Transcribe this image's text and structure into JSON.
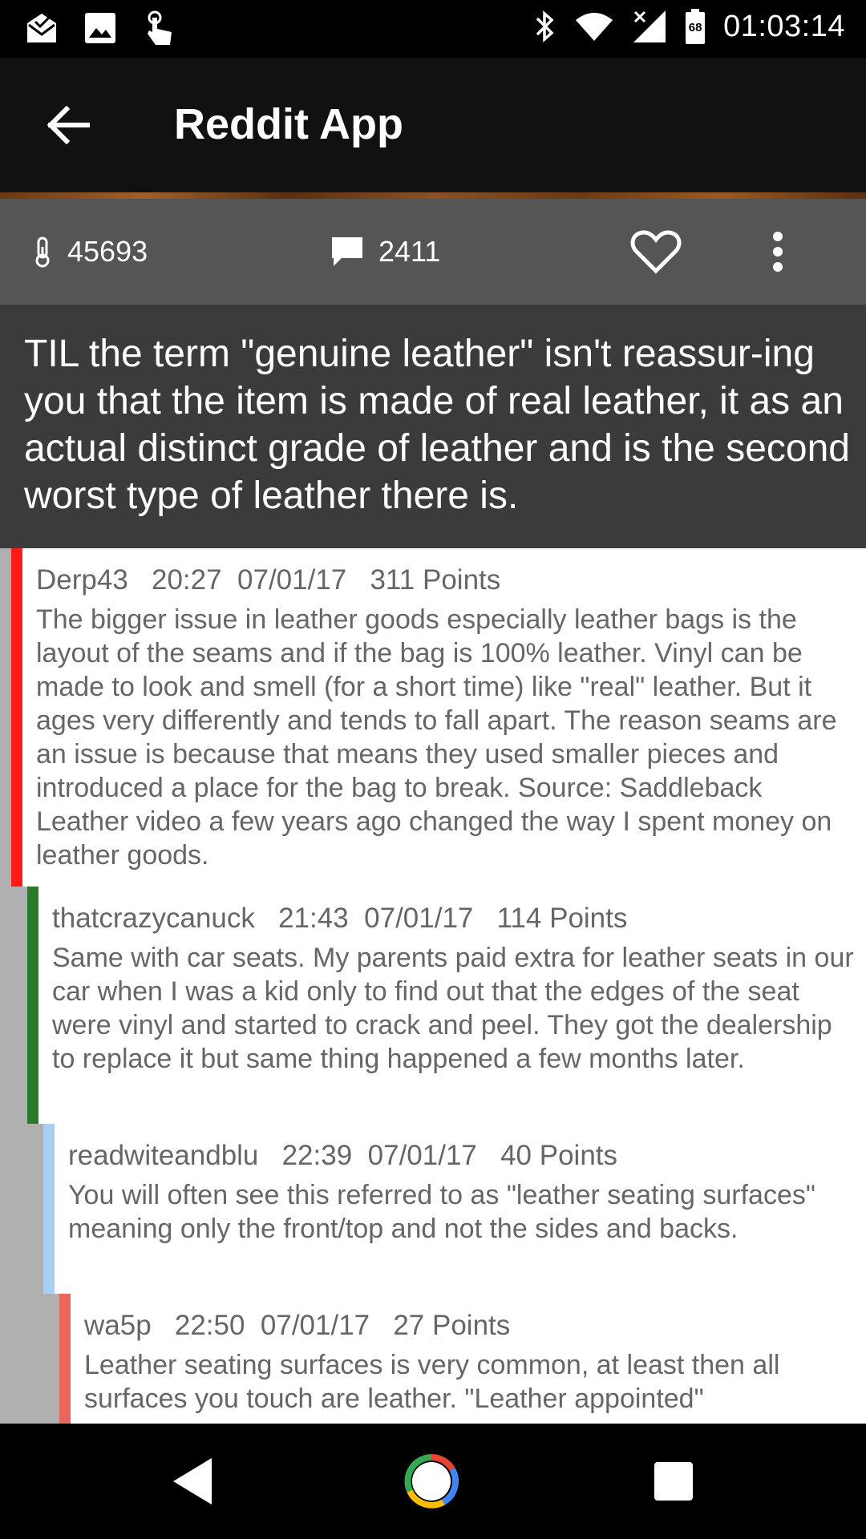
{
  "status_bar": {
    "time": "01:03:14",
    "battery_level": "68",
    "left_icons": [
      "mail-check-icon",
      "image-icon",
      "touch-icon"
    ],
    "right_icons": [
      "bluetooth-icon",
      "wifi-icon",
      "signal-off-icon",
      "battery-icon"
    ]
  },
  "app_bar": {
    "title": "Reddit App"
  },
  "post": {
    "score": "45693",
    "comment_count": "2411",
    "title": "TIL the term \"genuine leather\" isn't reassur-ing you that the item is made of real leather, it as an actual distinct grade of leather and is the second worst type of leather there is."
  },
  "comments": [
    {
      "author": "Derp43",
      "time": "20:27",
      "date": "07/01/17",
      "points": "311 Points",
      "depth_color": "#ff1a1a",
      "text": "The bigger issue in leather goods especially leather bags is the layout of the seams and if the bag is 100% leather. Vinyl can be made to look and smell (for a short time) like \"real\" leather. But it ages very differently and tends to fall apart. The reason seams are an issue is because that means they used smaller pieces and introduced a place for the bag to break. Source: Saddleback Leather video a few years ago changed the way I spent money on leather goods."
    },
    {
      "author": "thatcrazycanuck",
      "time": "21:43",
      "date": "07/01/17",
      "points": "114 Points",
      "depth_color": "#2a7a2a",
      "text": "Same with car seats. My parents paid extra for leather seats in our car when I was a kid only to find out that the edges of the seat were vinyl and started to crack and peel. They got the dealership to replace it but same thing happened a few months later."
    },
    {
      "author": "readwiteandblu",
      "time": "22:39",
      "date": "07/01/17",
      "points": "40 Points",
      "depth_color": "#a8d0f5",
      "text": "You will often see this referred to as \"leather seating surfaces\" meaning only the front/top and not the sides and backs."
    },
    {
      "author": "wa5p",
      "time": "22:50",
      "date": "07/01/17",
      "points": "27 Points",
      "depth_color": "#e8675a",
      "text": "Leather seating surfaces is very common, at least then all surfaces you touch are leather. \"Leather appointed\""
    }
  ],
  "nav_bar": {
    "icons": [
      "back-triangle-icon",
      "home-circle-icon",
      "recents-square-icon"
    ]
  }
}
